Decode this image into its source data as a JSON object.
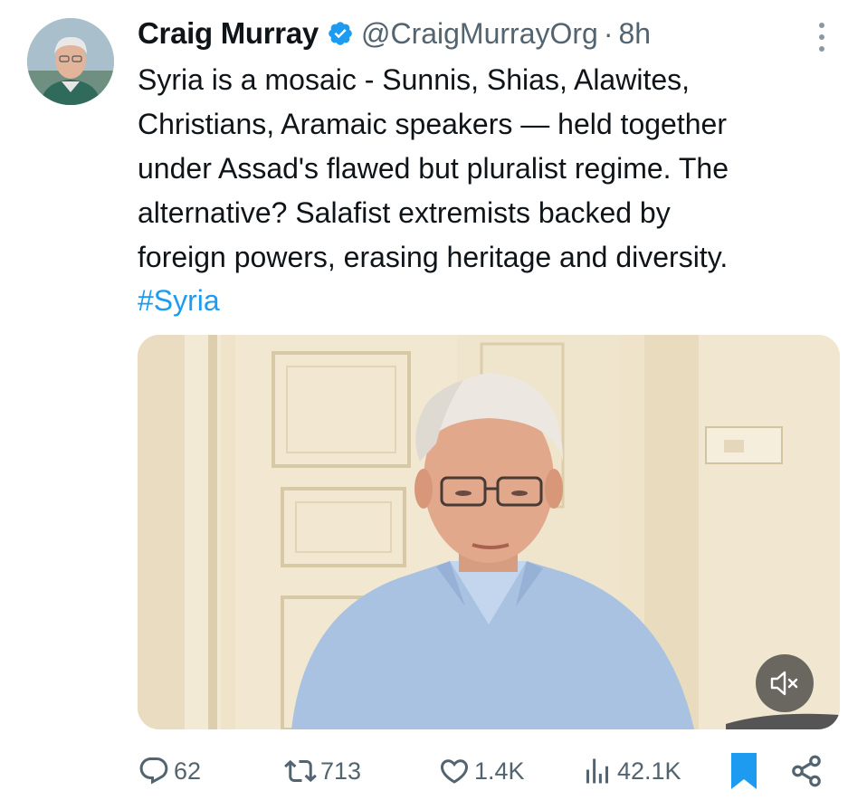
{
  "tweet": {
    "author_name": "Craig Murray",
    "handle": "@CraigMurrayOrg",
    "separator": "·",
    "time": "8h",
    "text": "Syria is a mosaic - Sunnis, Shias, Alawites,\nChristians, Aramaic speakers — held together\nunder Assad's flawed but pluralist regime. The\nalternative? Salafist extremists backed by\nforeign powers, erasing heritage and diversity.",
    "hashtag": "#Syria"
  },
  "icons": {
    "verified": "verified-badge-icon",
    "more": "more-options-icon",
    "mute": "volume-muted-icon",
    "reply": "reply-icon",
    "retweet": "retweet-icon",
    "like": "heart-icon",
    "views": "views-chart-icon",
    "bookmark": "bookmark-icon",
    "share": "share-icon"
  },
  "stats": {
    "replies": "62",
    "retweets": "713",
    "likes": "1.4K",
    "views": "42.1K"
  },
  "state": {
    "bookmarked": true,
    "video_muted": true
  },
  "colors": {
    "text": "#0f1419",
    "secondary": "#536471",
    "accent": "#1d9bf0",
    "bookmark_active": "#1d9bf0"
  }
}
